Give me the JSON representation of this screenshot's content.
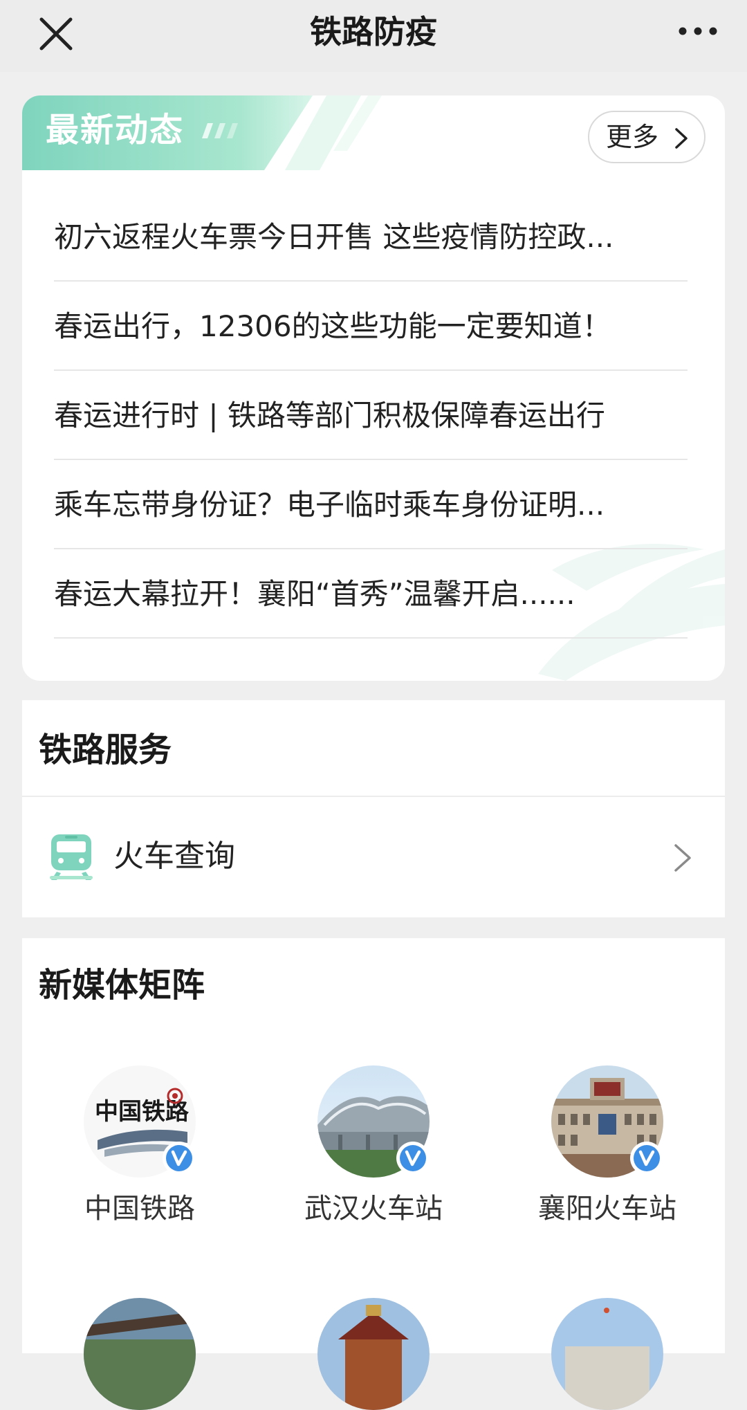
{
  "topbar": {
    "title": "铁路防疫",
    "close_icon": "close-icon",
    "more_icon": "more-dots-icon"
  },
  "news": {
    "section_title": "最新动态",
    "more_label": "更多",
    "items": [
      {
        "text": "初六返程火车票今日开售 这些疫情防控政..."
      },
      {
        "text": "春运出行，12306的这些功能一定要知道！"
      },
      {
        "text": "春运进行时 | 铁路等部门积极保障春运出行"
      },
      {
        "text": "乘车忘带身份证？电子临时乘车身份证明..."
      },
      {
        "text": "春运大幕拉开！襄阳“首秀”温馨开启......"
      }
    ],
    "accent_gradient": [
      "#7fd4bd",
      "#b9ecd9"
    ]
  },
  "services": {
    "section_title": "铁路服务",
    "items": [
      {
        "label": "火车查询",
        "icon": "train-icon"
      }
    ]
  },
  "media": {
    "section_title": "新媒体矩阵",
    "accounts": [
      {
        "name": "中国铁路",
        "avatar": "china-railway-logo"
      },
      {
        "name": "武汉火车站",
        "avatar": "wuhan-station-photo"
      },
      {
        "name": "襄阳火车站",
        "avatar": "xiangyang-station-photo"
      }
    ],
    "verified_color": "#3d8fe6"
  }
}
